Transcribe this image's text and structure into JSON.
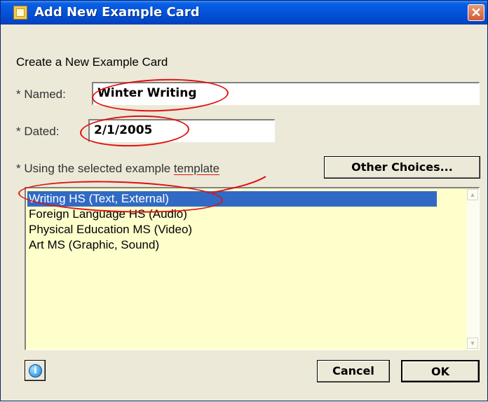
{
  "window": {
    "title": "Add New Example Card",
    "close_glyph": "✕"
  },
  "heading": "Create a New Example Card",
  "named": {
    "label": "* Named:",
    "value": "Winter Writing"
  },
  "dated": {
    "label": "* Dated:",
    "value": "2/1/2005"
  },
  "template": {
    "label_prefix": "* Using the selected example ",
    "label_link": "template"
  },
  "other_choices_label": "Other Choices...",
  "templates": [
    {
      "label": "Writing HS (Text, External)",
      "selected": true
    },
    {
      "label": "Foreign Language HS (Audio)",
      "selected": false
    },
    {
      "label": "Physical Education  MS (Video)",
      "selected": false
    },
    {
      "label": "Art MS (Graphic, Sound)",
      "selected": false
    }
  ],
  "buttons": {
    "cancel": "Cancel",
    "ok": "OK",
    "info_glyph": "i"
  },
  "icons": {
    "title": "card-icon",
    "info": "info-icon",
    "scroll_up": "chevron-up-icon",
    "scroll_down": "chevron-down-icon"
  },
  "colors": {
    "selection": "#316ac5",
    "list_bg": "#ffffcc",
    "annotation": "#e01010",
    "titlebar": "#0353d8"
  }
}
